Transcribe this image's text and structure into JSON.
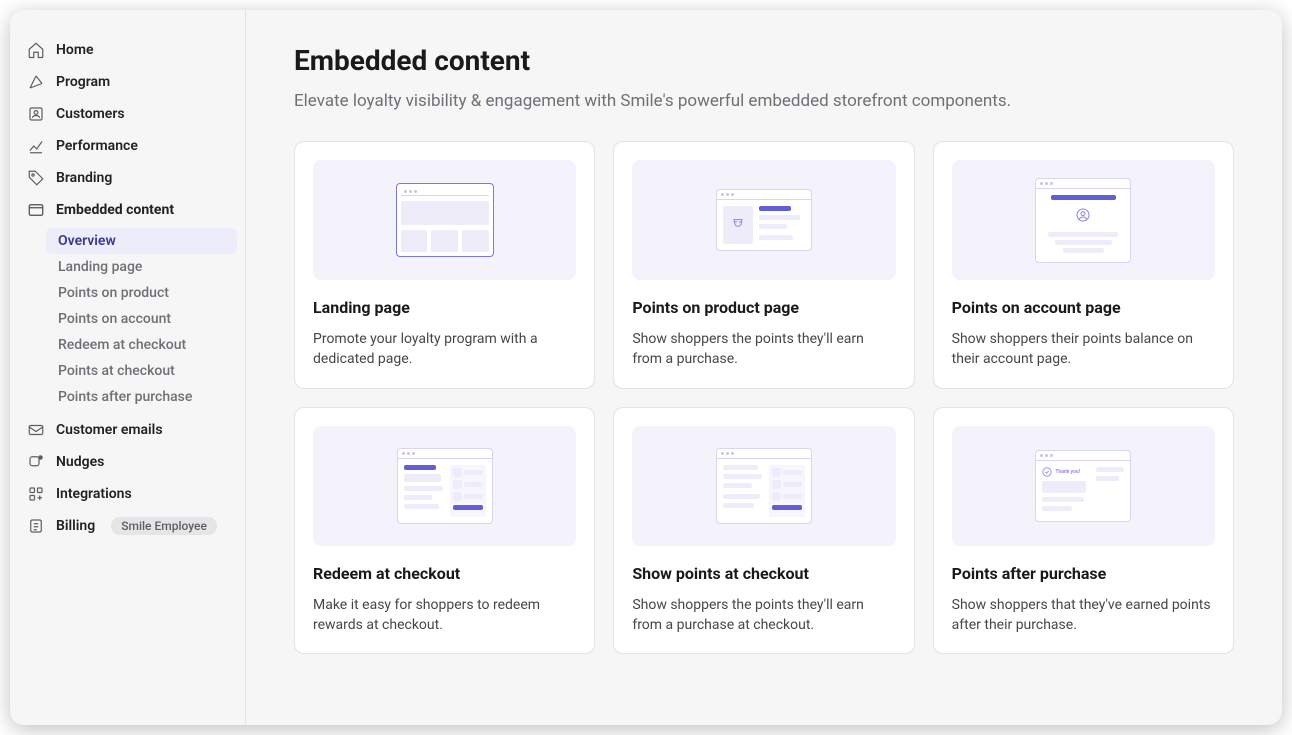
{
  "sidebar": {
    "items": [
      {
        "label": "Home",
        "icon": "home"
      },
      {
        "label": "Program",
        "icon": "program"
      },
      {
        "label": "Customers",
        "icon": "customers"
      },
      {
        "label": "Performance",
        "icon": "performance"
      },
      {
        "label": "Branding",
        "icon": "branding"
      },
      {
        "label": "Embedded content",
        "icon": "embedded"
      },
      {
        "label": "Customer emails",
        "icon": "email"
      },
      {
        "label": "Nudges",
        "icon": "nudges"
      },
      {
        "label": "Integrations",
        "icon": "integrations"
      },
      {
        "label": "Billing",
        "icon": "billing",
        "badge": "Smile Employee"
      }
    ],
    "embedded_sub": [
      {
        "label": "Overview",
        "selected": true
      },
      {
        "label": "Landing page"
      },
      {
        "label": "Points on product"
      },
      {
        "label": "Points on account"
      },
      {
        "label": "Redeem at checkout"
      },
      {
        "label": "Points at checkout"
      },
      {
        "label": "Points after purchase"
      }
    ]
  },
  "page": {
    "title": "Embedded content",
    "subtitle": "Elevate loyalty visibility & engagement with Smile's powerful embedded storefront components."
  },
  "cards": [
    {
      "title": "Landing page",
      "desc": "Promote your loyalty program with a dedicated page."
    },
    {
      "title": "Points on product page",
      "desc": "Show shoppers the points they'll earn from a purchase."
    },
    {
      "title": "Points on account page",
      "desc": "Show shoppers their points balance on their account page."
    },
    {
      "title": "Redeem at checkout",
      "desc": "Make it easy for shoppers to redeem rewards at checkout."
    },
    {
      "title": "Show points at checkout",
      "desc": "Show shoppers the points they'll earn from a purchase at checkout."
    },
    {
      "title": "Points after purchase",
      "desc": "Show shoppers that they've earned points after their purchase."
    }
  ]
}
